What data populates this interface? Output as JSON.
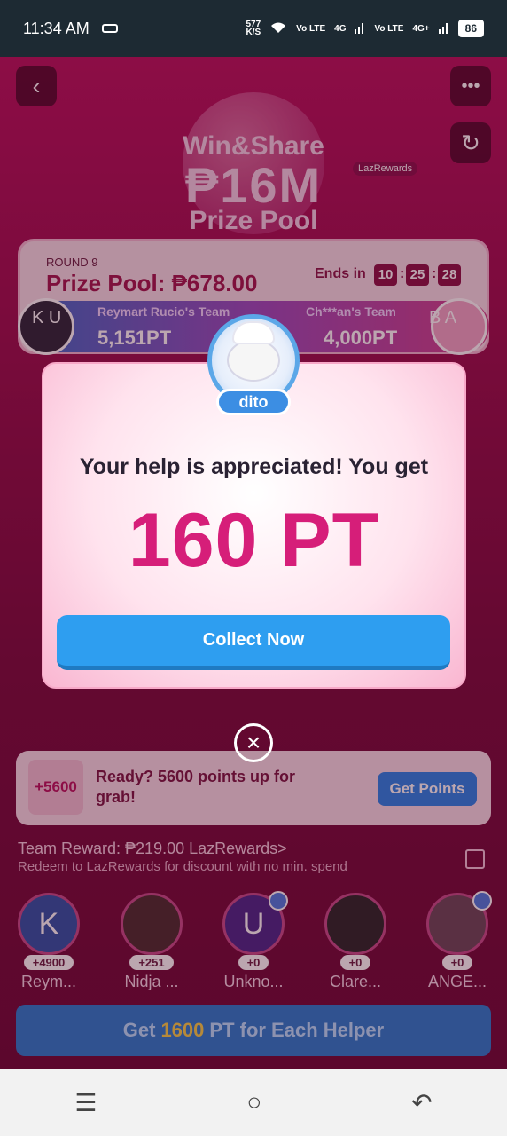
{
  "status_bar": {
    "time": "11:34 AM",
    "speed_value": "577",
    "speed_unit": "K/S",
    "net1": "Vo LTE",
    "net1_gen": "4G",
    "net2": "Vo LTE",
    "net2_gen": "4G+",
    "battery": "86"
  },
  "top": {
    "back_icon": "chevron-left-icon",
    "more_icon": "more-dots-icon",
    "refresh_icon": "refresh-icon"
  },
  "banner": {
    "line1": "Win&Share",
    "amount": "₱16M",
    "line2": "Prize Pool",
    "tag": "LazRewards"
  },
  "round": {
    "label": "ROUND 9",
    "prize_pool": "Prize Pool: ₱678.00",
    "ends_label": "Ends in",
    "hours": "10",
    "minutes": "25",
    "seconds": "28",
    "team_left": {
      "name": "Reymart Rucio's Team",
      "points": "5,151PT",
      "letters": "K U"
    },
    "team_right": {
      "name": "Ch***an's Team",
      "points": "4,000PT",
      "letters": "B A"
    }
  },
  "modal": {
    "avatar_name": "dito",
    "message": "Your help is appreciated! You get",
    "points": "160 PT",
    "collect_label": "Collect Now",
    "close_icon": "close-icon"
  },
  "cta": {
    "badge": "+5600",
    "text": "Ready? 5600 points up for grab!",
    "button": "Get Points"
  },
  "team_reward": {
    "label": "Team Reward: ₱219.00",
    "link": "LazRewards>",
    "redeem": "Redeem to LazRewards for discount with no min. spend"
  },
  "helpers": [
    {
      "letter": "K",
      "points": "+4900",
      "name": "Reym..."
    },
    {
      "letter": "",
      "points": "+251",
      "name": "Nidja ..."
    },
    {
      "letter": "U",
      "points": "+0",
      "name": "Unkno..."
    },
    {
      "letter": "",
      "points": "+0",
      "name": "Clare..."
    },
    {
      "letter": "",
      "points": "+0",
      "name": "ANGE..."
    }
  ],
  "bottom_cta": {
    "prefix": "Get",
    "highlight": "1600",
    "suffix": "PT for Each Helper"
  },
  "navbar": {
    "menu_icon": "menu-icon",
    "home_icon": "home-circle-icon",
    "back_icon": "back-arrow-icon"
  }
}
